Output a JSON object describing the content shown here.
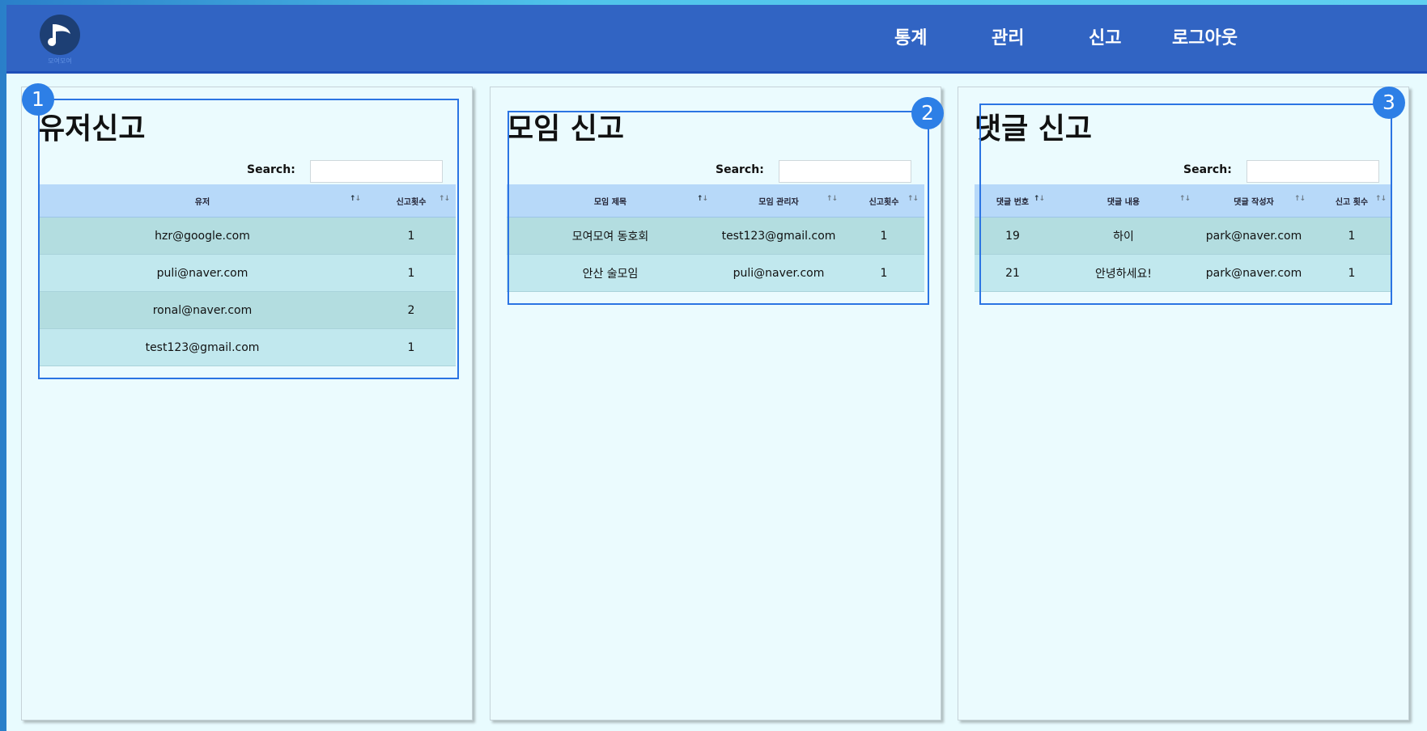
{
  "app": {
    "logo_caption": "모여모여",
    "nav": [
      "통계",
      "관리",
      "신고",
      "로그아웃"
    ]
  },
  "colors": {
    "header": "#3164c3",
    "table_header": "#b7d9f9",
    "annotation": "#2d7fe6"
  },
  "panels": [
    {
      "title": "유저신고",
      "search_label": "Search:",
      "columns": [
        "유저",
        "신고횟수"
      ],
      "rows": [
        [
          "hzr@google.com",
          "1"
        ],
        [
          "puli@naver.com",
          "1"
        ],
        [
          "ronal@naver.com",
          "2"
        ],
        [
          "test123@gmail.com",
          "1"
        ]
      ]
    },
    {
      "title": "모임 신고",
      "search_label": "Search:",
      "columns": [
        "모임 제목",
        "모임 관리자",
        "신고횟수"
      ],
      "rows": [
        [
          "모여모여 동호회",
          "test123@gmail.com",
          "1"
        ],
        [
          "안산 술모임",
          "puli@naver.com",
          "1"
        ]
      ]
    },
    {
      "title": "댓글 신고",
      "search_label": "Search:",
      "columns": [
        "댓글 번호",
        "댓글 내용",
        "댓글 작성자",
        "신고 횟수"
      ],
      "rows": [
        [
          "19",
          "하이",
          "park@naver.com",
          "1"
        ],
        [
          "21",
          "안녕하세요!",
          "park@naver.com",
          "1"
        ]
      ]
    }
  ],
  "annotations": [
    "1",
    "2",
    "3"
  ]
}
